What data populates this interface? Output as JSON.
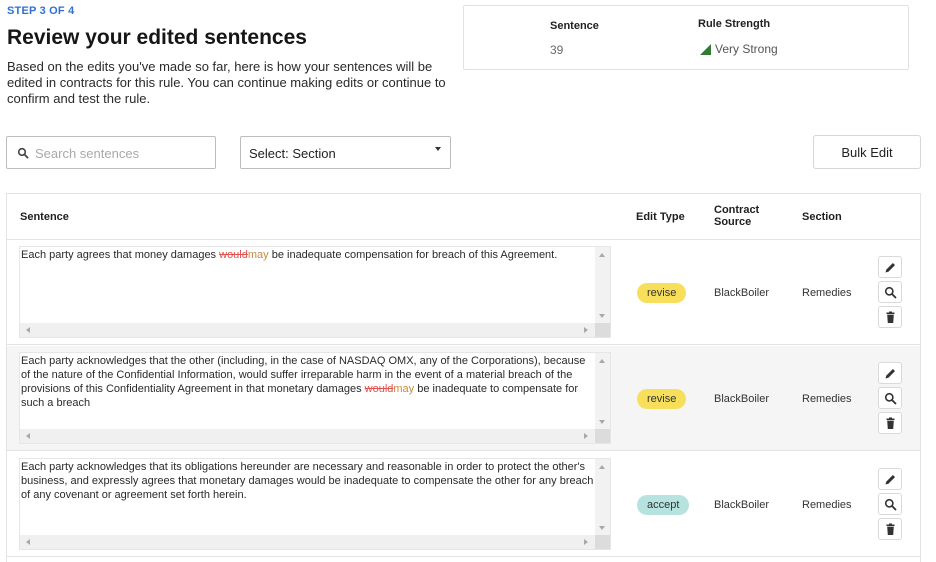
{
  "header": {
    "step": "STEP 3 OF 4",
    "title": "Review your edited sentences",
    "description": "Based on the edits you've made so far, here is how your sentences will be edited in contracts for this rule. You can continue making edits or continue to confirm and test the rule."
  },
  "stats": {
    "sentence_label": "Sentence",
    "sentence_value": "39",
    "strength_label": "Rule Strength",
    "strength_value": "Very Strong",
    "strength_color": "#2e7d32"
  },
  "toolbar": {
    "search_placeholder": "Search sentences",
    "section_select": "Select: Section",
    "bulk_edit_label": "Bulk Edit"
  },
  "table": {
    "columns": [
      "Sentence",
      "Edit Type",
      "Contract Source",
      "Section"
    ],
    "rows": [
      {
        "before": "Each party agrees that money damages ",
        "deleted": "would",
        "inserted": "may",
        "after": " be inadequate compensation for breach of this Agreement.",
        "edit_type": "revise",
        "source": "BlackBoiler",
        "section": "Remedies"
      },
      {
        "before": "Each party acknowledges that the other (including, in the case of NASDAQ OMX, any of the Corporations), because of the nature of the Confidential Information, would suffer irreparable harm in the event of a material breach of the provisions of this Confidentiality Agreement in that monetary damages ",
        "deleted": "would",
        "inserted": "may",
        "after": " be inadequate to compensate for such a breach",
        "edit_type": "revise",
        "source": "BlackBoiler",
        "section": "Remedies"
      },
      {
        "before": "Each party acknowledges that its obligations hereunder are necessary and reasonable in order to protect the other's business, and expressly agrees that monetary damages would be inadequate to compensate the other for any breach of any covenant or agreement set forth herein.",
        "deleted": "",
        "inserted": "",
        "after": "",
        "edit_type": "accept",
        "source": "BlackBoiler",
        "section": "Remedies"
      }
    ]
  },
  "colors": {
    "accent": "#2f6fd6",
    "deleted_text": "#e0524f",
    "inserted_text": "#c88a3c",
    "revise_pill": "#f7df5c",
    "accept_pill": "#b6e3e0"
  }
}
